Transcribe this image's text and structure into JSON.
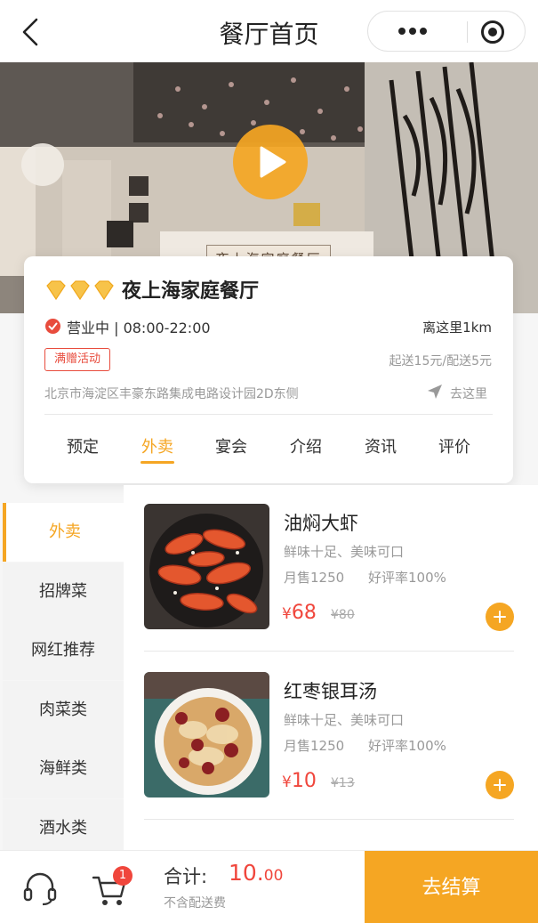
{
  "navbar": {
    "title": "餐厅首页"
  },
  "hero": {
    "sign_text": "夜上海家庭餐厅"
  },
  "restaurant": {
    "name": "夜上海家庭餐厅",
    "rating_diamonds": 3,
    "status": "营业中 | 08:00-22:00",
    "distance": "离这里1km",
    "promo_badge": "满赠活动",
    "delivery": "起送15元/配送5元",
    "address": "北京市海淀区丰豪东路集成电路设计园2D东侧",
    "navigate_label": "去这里"
  },
  "tabs": [
    {
      "label": "预定",
      "active": false
    },
    {
      "label": "外卖",
      "active": true
    },
    {
      "label": "宴会",
      "active": false
    },
    {
      "label": "介绍",
      "active": false
    },
    {
      "label": "资讯",
      "active": false
    },
    {
      "label": "评价",
      "active": false
    }
  ],
  "categories": [
    {
      "label": "外卖",
      "active": true
    },
    {
      "label": "招牌菜",
      "active": false
    },
    {
      "label": "网红推荐",
      "active": false
    },
    {
      "label": "肉菜类",
      "active": false
    },
    {
      "label": "海鲜类",
      "active": false
    },
    {
      "label": "酒水类",
      "active": false
    }
  ],
  "dishes": [
    {
      "name": "油焖大虾",
      "desc": "鲜味十足、美味可口",
      "sales": "月售1250",
      "rating": "好评率100%",
      "currency": "¥",
      "price": "68",
      "old_price": "¥80",
      "image": "shrimp-dish"
    },
    {
      "name": "红枣银耳汤",
      "desc": "鲜味十足、美味可口",
      "sales": "月售1250",
      "rating": "好评率100%",
      "currency": "¥",
      "price": "10",
      "old_price": "¥13",
      "image": "jujube-soup"
    }
  ],
  "cart": {
    "badge": "1",
    "total_label": "合计:",
    "total_int": "10.",
    "total_dec": "00",
    "fee_note": "不含配送费",
    "checkout_label": "去结算"
  },
  "colors": {
    "accent": "#f5a623",
    "price_red": "#f0463c",
    "status_red": "#e84c3d"
  }
}
